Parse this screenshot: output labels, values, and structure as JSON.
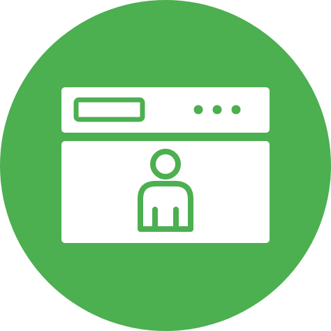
{
  "icon": {
    "name": "browser-user-profile-icon",
    "colors": {
      "background": "#ffffff",
      "circle": "#4caf50",
      "window": "#ffffff",
      "detail": "#4caf50"
    }
  }
}
